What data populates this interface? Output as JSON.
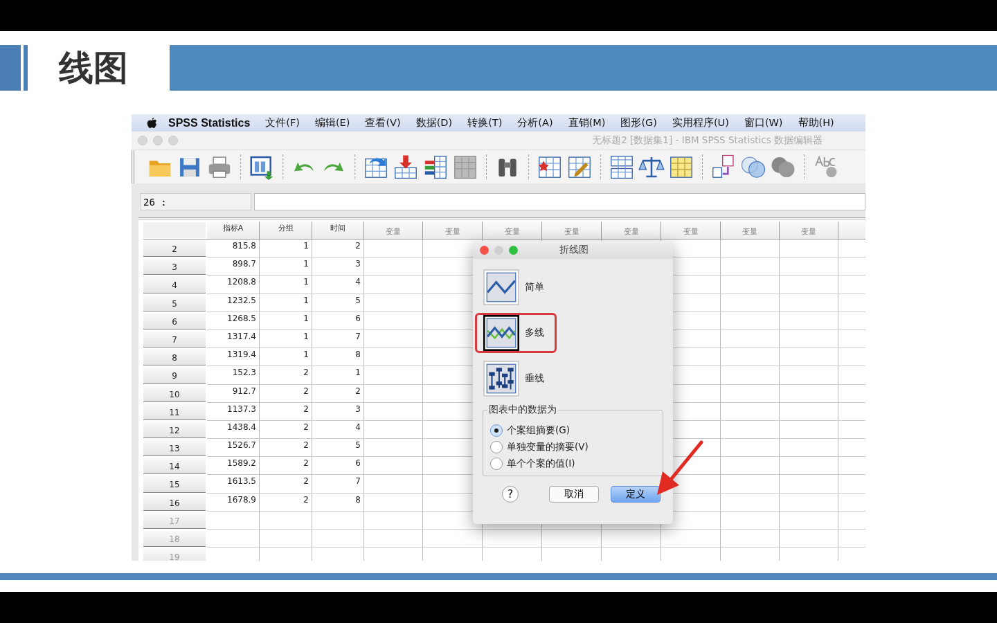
{
  "slide": {
    "title": "线图"
  },
  "menu_bar": {
    "app_name": "SPSS Statistics",
    "items": [
      "文件(F)",
      "编辑(E)",
      "查看(V)",
      "数据(D)",
      "转换(T)",
      "分析(A)",
      "直销(M)",
      "图形(G)",
      "实用程序(U)",
      "窗口(W)",
      "帮助(H)"
    ]
  },
  "window": {
    "title": "无标题2 [数据集1] - IBM SPSS Statistics 数据编辑器"
  },
  "cell_editor": {
    "reference": "26 :"
  },
  "table": {
    "columns": [
      "指标A",
      "分组",
      "时间",
      "变量",
      "变量",
      "变量",
      "变量",
      "变量",
      "变量",
      "变量",
      "变量"
    ],
    "rows": [
      {
        "number": "2",
        "active": true,
        "cells": [
          "815.8",
          "1",
          "2"
        ]
      },
      {
        "number": "3",
        "active": true,
        "cells": [
          "898.7",
          "1",
          "3"
        ]
      },
      {
        "number": "4",
        "active": true,
        "cells": [
          "1208.8",
          "1",
          "4"
        ]
      },
      {
        "number": "5",
        "active": true,
        "cells": [
          "1232.5",
          "1",
          "5"
        ]
      },
      {
        "number": "6",
        "active": true,
        "cells": [
          "1268.5",
          "1",
          "6"
        ]
      },
      {
        "number": "7",
        "active": true,
        "cells": [
          "1317.4",
          "1",
          "7"
        ]
      },
      {
        "number": "8",
        "active": true,
        "cells": [
          "1319.4",
          "1",
          "8"
        ]
      },
      {
        "number": "9",
        "active": true,
        "cells": [
          "152.3",
          "2",
          "1"
        ]
      },
      {
        "number": "10",
        "active": true,
        "cells": [
          "912.7",
          "2",
          "2"
        ]
      },
      {
        "number": "11",
        "active": true,
        "cells": [
          "1137.3",
          "2",
          "3"
        ]
      },
      {
        "number": "12",
        "active": true,
        "cells": [
          "1438.4",
          "2",
          "4"
        ]
      },
      {
        "number": "13",
        "active": true,
        "cells": [
          "1526.7",
          "2",
          "5"
        ]
      },
      {
        "number": "14",
        "active": true,
        "cells": [
          "1589.2",
          "2",
          "6"
        ]
      },
      {
        "number": "15",
        "active": true,
        "cells": [
          "1613.5",
          "2",
          "7"
        ]
      },
      {
        "number": "16",
        "active": true,
        "cells": [
          "1678.9",
          "2",
          "8"
        ]
      },
      {
        "number": "17",
        "active": false,
        "cells": []
      },
      {
        "number": "18",
        "active": false,
        "cells": []
      },
      {
        "number": "19",
        "active": false,
        "cells": []
      }
    ]
  },
  "dialog": {
    "title": "折线图",
    "chart_types": [
      {
        "label": "简单",
        "kind": "simple",
        "selected": false,
        "highlighted": false
      },
      {
        "label": "多线",
        "kind": "multiple",
        "selected": true,
        "highlighted": true
      },
      {
        "label": "垂线",
        "kind": "drop",
        "selected": false,
        "highlighted": false
      }
    ],
    "data_group": {
      "legend": "图表中的数据为",
      "options": [
        {
          "label": "个案组摘要(G)",
          "selected": true
        },
        {
          "label": "单独变量的摘要(V)",
          "selected": false
        },
        {
          "label": "单个个案的值(I)",
          "selected": false
        }
      ]
    },
    "help_button": "?",
    "buttons": [
      {
        "label": "取消",
        "kind": "cancel"
      },
      {
        "label": "定义",
        "kind": "default"
      }
    ]
  }
}
